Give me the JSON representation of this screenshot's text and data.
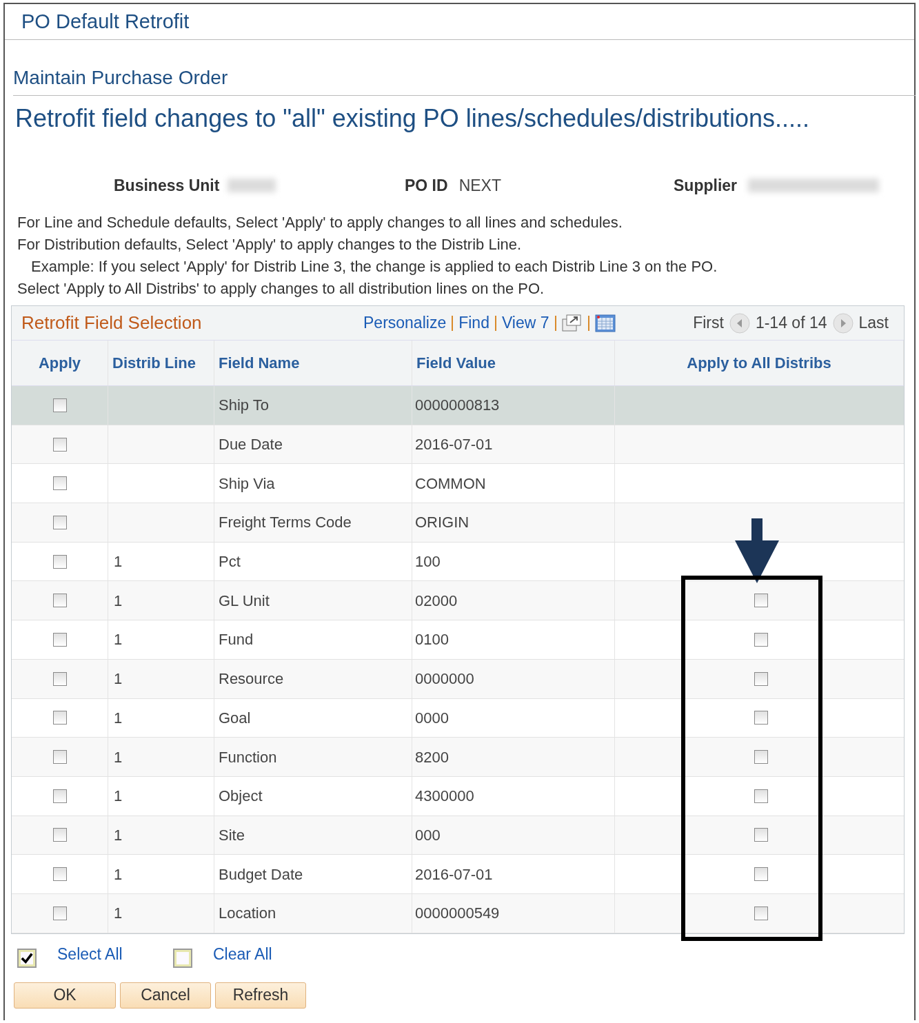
{
  "window": {
    "title": "PO Default Retrofit"
  },
  "page_title": "Maintain Purchase Order",
  "heading": "Retrofit field changes to \"all\" existing PO lines/schedules/distributions.....",
  "header_fields": [
    {
      "label": "Business Unit",
      "redacted": true
    },
    {
      "label": "PO ID",
      "value": "NEXT"
    },
    {
      "label": "Supplier",
      "redacted": true
    }
  ],
  "instructions": [
    {
      "text": "For Line and Schedule defaults, Select 'Apply' to apply changes to all lines and schedules.",
      "indented": false
    },
    {
      "text": "For Distribution defaults, Select 'Apply' to apply changes to the Distrib Line.",
      "indented": false
    },
    {
      "text": "Example: If you select 'Apply' for Distrib Line 3, the change is applied to each Distrib Line 3 on the PO.",
      "indented": true
    },
    {
      "text": "Select 'Apply to All Distribs' to apply changes to all distribution lines on the PO.",
      "indented": false
    }
  ],
  "grid": {
    "title": "Retrofit Field Selection",
    "links": [
      "Personalize",
      "Find",
      "View 7"
    ],
    "nav": {
      "first": "First",
      "range": "1-14 of 14",
      "last": "Last"
    },
    "columns": [
      "Apply",
      "Distrib Line",
      "Field Name",
      "Field Value",
      "Apply to All Distribs"
    ],
    "rows": [
      {
        "apply": false,
        "distrib_line": "",
        "field_name": "Ship To",
        "field_value": "0000000813",
        "selected": true
      },
      {
        "apply": false,
        "distrib_line": "",
        "field_name": "Due Date",
        "field_value": "2016-07-01",
        "selected": false
      },
      {
        "apply": false,
        "distrib_line": "",
        "field_name": "Ship Via",
        "field_value": "COMMON",
        "selected": false
      },
      {
        "apply": false,
        "distrib_line": "",
        "field_name": "Freight Terms Code",
        "field_value": "ORIGIN",
        "selected": false
      },
      {
        "apply": false,
        "distrib_line": "1",
        "field_name": "Pct",
        "field_value": "100",
        "selected": false
      },
      {
        "apply": false,
        "distrib_line": "1",
        "field_name": "GL Unit",
        "field_value": "02000",
        "selected": false,
        "apply_all": false
      },
      {
        "apply": false,
        "distrib_line": "1",
        "field_name": "Fund",
        "field_value": "0100",
        "selected": false,
        "apply_all": false
      },
      {
        "apply": false,
        "distrib_line": "1",
        "field_name": "Resource",
        "field_value": "0000000",
        "selected": false,
        "apply_all": false
      },
      {
        "apply": false,
        "distrib_line": "1",
        "field_name": "Goal",
        "field_value": "0000",
        "selected": false,
        "apply_all": false
      },
      {
        "apply": false,
        "distrib_line": "1",
        "field_name": "Function",
        "field_value": "8200",
        "selected": false,
        "apply_all": false
      },
      {
        "apply": false,
        "distrib_line": "1",
        "field_name": "Object",
        "field_value": "4300000",
        "selected": false,
        "apply_all": false
      },
      {
        "apply": false,
        "distrib_line": "1",
        "field_name": "Site",
        "field_value": "000",
        "selected": false,
        "apply_all": false
      },
      {
        "apply": false,
        "distrib_line": "1",
        "field_name": "Budget Date",
        "field_value": "2016-07-01",
        "selected": false,
        "apply_all": false
      },
      {
        "apply": false,
        "distrib_line": "1",
        "field_name": "Location",
        "field_value": "0000000549",
        "selected": false,
        "apply_all": false
      }
    ]
  },
  "bulk_actions": [
    {
      "label": "Select All",
      "checked": true
    },
    {
      "label": "Clear All",
      "checked": false
    }
  ],
  "buttons": [
    "OK",
    "Cancel",
    "Refresh"
  ]
}
